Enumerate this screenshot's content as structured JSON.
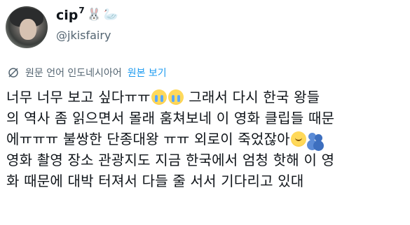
{
  "profile": {
    "display_name": "cip",
    "superscript": "7",
    "name_emoji_1": "🐰",
    "name_emoji_2": "🦢",
    "handle": "@jkisfairy"
  },
  "translation": {
    "label": "원문 언어 인도네시아어",
    "link": "원본 보기"
  },
  "tweet": {
    "line1_a": "너무 너무 보고 싶다ㅠㅠ",
    "line1_b": " 그래서 다시 한국 왕들",
    "line2": "의 역사 좀 읽으면서 몰래 훔쳐보네 이 영화 클립들 때문",
    "line3_a": "에ㅠㅠㅠ 불쌍한 단종대왕 ㅠㅠ 외로이 죽었잖아",
    "line4": "영화 촬영 장소 관광지도 지금 한국에서 엄청 핫해 이 영",
    "line5": "화 때문에 대박 터져서 다들 줄 서서 기다리고 있대"
  },
  "emoji": {
    "crying": "loudly-crying-face",
    "teary": "face-holding-back-tears",
    "hug": "people-hugging"
  }
}
